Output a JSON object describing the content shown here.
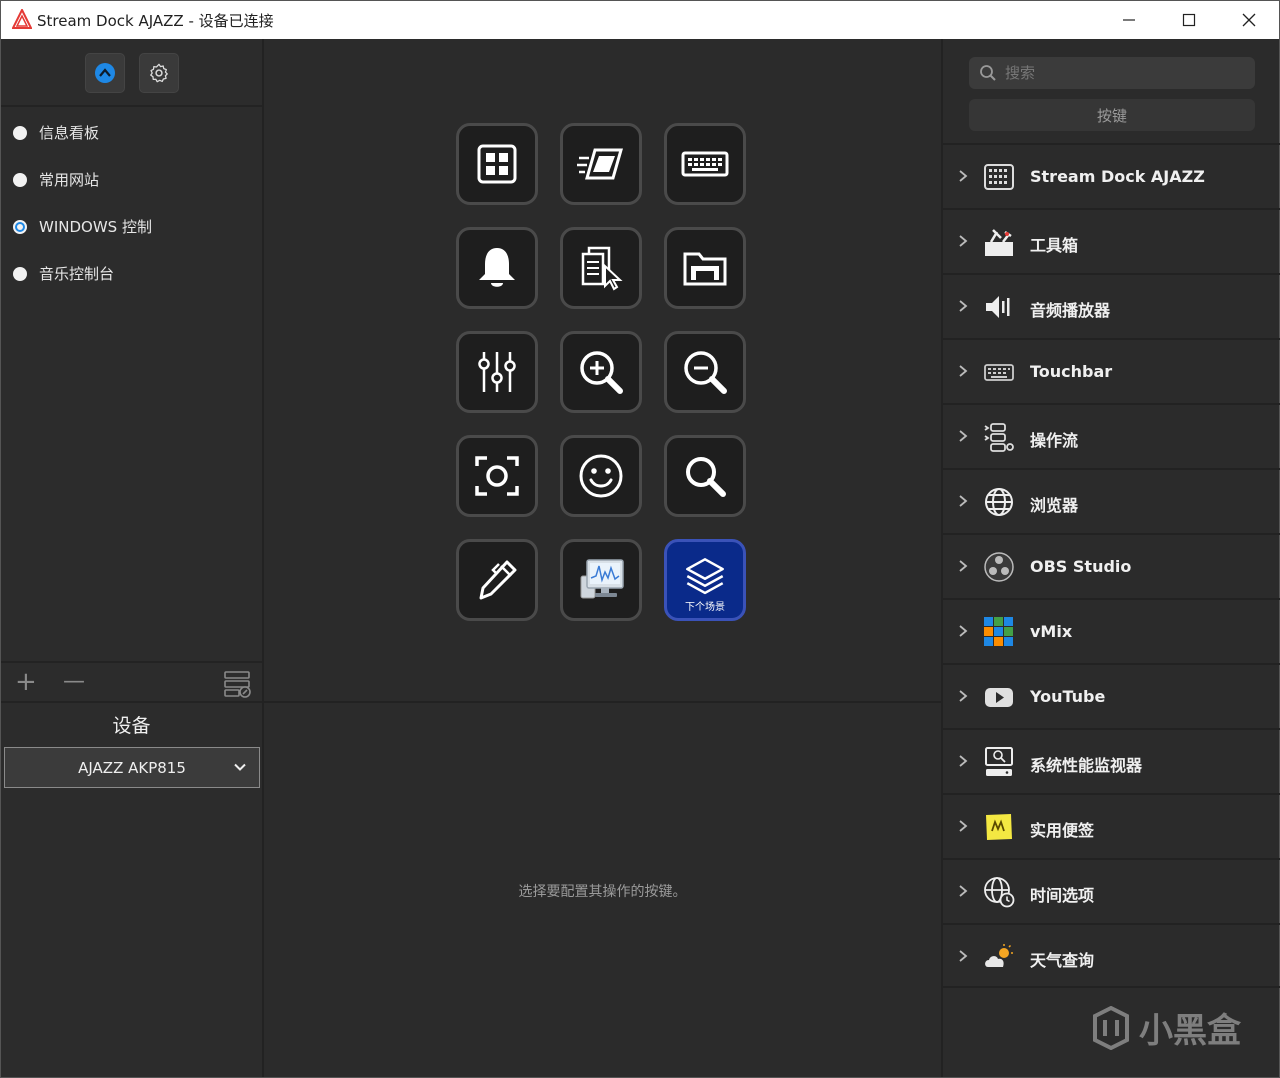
{
  "window": {
    "title": "Stream Dock AJAZZ - 设备已连接"
  },
  "profiles": [
    {
      "label": "信息看板",
      "selected": false
    },
    {
      "label": "常用网站",
      "selected": false
    },
    {
      "label": "WINDOWS 控制",
      "selected": true
    },
    {
      "label": "音乐控制台",
      "selected": false
    }
  ],
  "left_tools": {
    "add": "+",
    "remove": "—"
  },
  "device": {
    "heading": "设备",
    "selected": "AJAZZ AKP815"
  },
  "keys": [
    {
      "icon": "grid-icon"
    },
    {
      "icon": "window-motion-icon"
    },
    {
      "icon": "keyboard-icon"
    },
    {
      "icon": "bell-icon"
    },
    {
      "icon": "document-pointer-icon"
    },
    {
      "icon": "folder-icon"
    },
    {
      "icon": "sliders-icon"
    },
    {
      "icon": "zoom-in-icon"
    },
    {
      "icon": "zoom-out-icon"
    },
    {
      "icon": "screenshot-icon"
    },
    {
      "icon": "smiley-icon"
    },
    {
      "icon": "search-icon"
    },
    {
      "icon": "pen-icon"
    },
    {
      "icon": "monitor-chart-icon"
    },
    {
      "icon": "layers-icon",
      "label": "下个场景",
      "active": true
    }
  ],
  "hint": "选择要配置其操作的按键。",
  "search": {
    "placeholder": "搜索"
  },
  "keys_button": "按键",
  "categories": [
    {
      "label": "Stream Dock AJAZZ",
      "icon": "keypad-icon"
    },
    {
      "label": "工具箱",
      "icon": "toolbox-icon"
    },
    {
      "label": "音频播放器",
      "icon": "speaker-icon"
    },
    {
      "label": "Touchbar",
      "icon": "touchbar-icon"
    },
    {
      "label": "操作流",
      "icon": "workflow-icon"
    },
    {
      "label": "浏览器",
      "icon": "globe-icon"
    },
    {
      "label": "OBS Studio",
      "icon": "obs-icon"
    },
    {
      "label": "vMix",
      "icon": "vmix-icon"
    },
    {
      "label": "YouTube",
      "icon": "youtube-icon"
    },
    {
      "label": "系统性能监视器",
      "icon": "system-monitor-icon"
    },
    {
      "label": "实用便签",
      "icon": "sticky-note-icon"
    },
    {
      "label": "时间选项",
      "icon": "world-clock-icon"
    },
    {
      "label": "天气查询",
      "icon": "weather-icon"
    }
  ],
  "watermark": "小黑盒",
  "colors": {
    "accent": "#1e88e5",
    "active_key": "#0a2a8a",
    "background": "#2b2b2b"
  }
}
